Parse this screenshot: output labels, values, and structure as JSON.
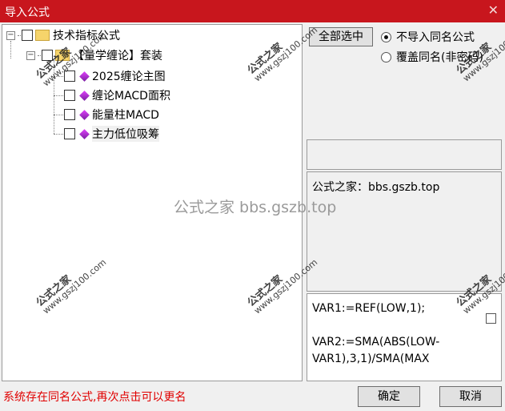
{
  "window": {
    "title": "导入公式",
    "close_glyph": "✕"
  },
  "tree": {
    "root": "技术指标公式",
    "group": "【量学缠论】套装",
    "items": [
      "2025缠论主图",
      "缠论MACD面积",
      "能量柱MACD",
      "主力低位吸筹"
    ]
  },
  "actions": {
    "select_all": "全部选中",
    "ok": "确定",
    "cancel": "取消"
  },
  "options": {
    "skip_same_name": "不导入同名公式",
    "overwrite_same_name": "覆盖同名(非密码)"
  },
  "info_text": "公式之家：bbs.gszb.top",
  "code_preview": [
    "VAR1:=REF(LOW,1);",
    "",
    "VAR2:=SMA(ABS(LOW-",
    "VAR1),3,1)/SMA(MAX"
  ],
  "status_message": "系统存在同名公式,再次点击可以更名",
  "watermark": {
    "title": "公式之家",
    "url": "www.gszj100.com",
    "center": "公式之家 bbs.gszb.top"
  }
}
